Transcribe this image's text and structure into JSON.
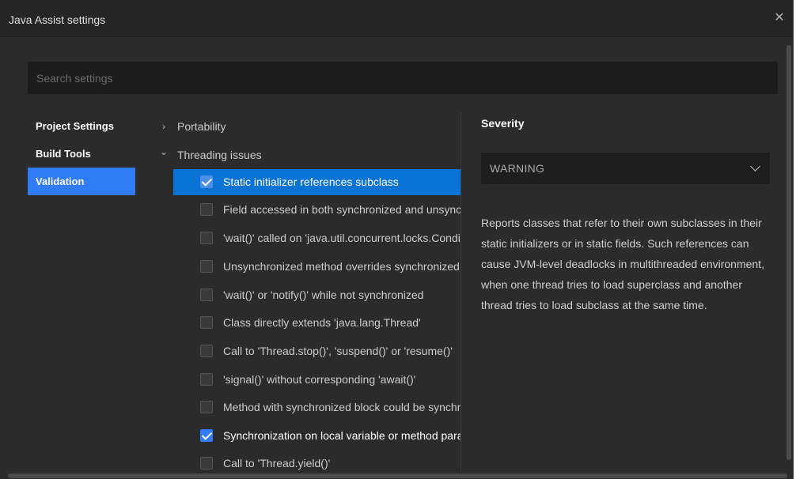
{
  "window": {
    "title": "Java Assist settings",
    "close_glyph": "✕"
  },
  "search": {
    "placeholder": "Search settings"
  },
  "nav": {
    "items": [
      {
        "label": "Project Settings",
        "active": false
      },
      {
        "label": "Build Tools",
        "active": false
      },
      {
        "label": "Validation",
        "active": true
      }
    ]
  },
  "tree": {
    "groups": [
      {
        "label": "Portability",
        "expanded": false,
        "chevron": "›"
      },
      {
        "label": "Threading issues",
        "expanded": true,
        "chevron": "⌄"
      }
    ],
    "rules": [
      {
        "label": "Static initializer references subclass",
        "checked": true,
        "selected": true
      },
      {
        "label": "Field accessed in both synchronized and unsynchronized contexts",
        "checked": false,
        "selected": false
      },
      {
        "label": "'wait()' called on 'java.util.concurrent.locks.Condition' object",
        "checked": false,
        "selected": false
      },
      {
        "label": "Unsynchronized method overrides synchronized method",
        "checked": false,
        "selected": false
      },
      {
        "label": "'wait()' or 'notify()' while not synchronized",
        "checked": false,
        "selected": false
      },
      {
        "label": "Class directly extends 'java.lang.Thread'",
        "checked": false,
        "selected": false
      },
      {
        "label": "Call to 'Thread.stop()', 'suspend()' or 'resume()'",
        "checked": false,
        "selected": false
      },
      {
        "label": "'signal()' without corresponding 'await()'",
        "checked": false,
        "selected": false
      },
      {
        "label": "Method with synchronized block could be synchronized method",
        "checked": false,
        "selected": false
      },
      {
        "label": "Synchronization on local variable or method parameter",
        "checked": true,
        "selected": false
      },
      {
        "label": "Call to 'Thread.yield()'",
        "checked": false,
        "selected": false
      }
    ]
  },
  "details": {
    "severity_label": "Severity",
    "severity_value": "WARNING",
    "description": "Reports classes that refer to their own subclasses in their static initializers or in static fields. Such references can cause JVM-level deadlocks in multithreaded environment, when one thread tries to load superclass and another thread tries to load subclass at the same time."
  },
  "colors": {
    "accent": "#2f7cf6",
    "selected_row": "#0a74d6",
    "background": "#2b2b2b",
    "input_background": "#1c1c1c"
  }
}
